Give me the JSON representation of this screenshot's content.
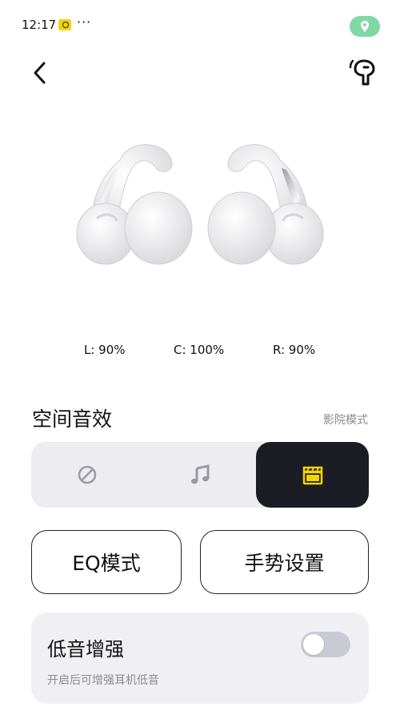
{
  "status_bar": {
    "time": "12:17",
    "dots": "···",
    "app_icon": "app-notification-icon",
    "location_icon": "location-pin-icon"
  },
  "header": {
    "back_icon": "back-arrow-icon",
    "device_icon": "earbud-icon"
  },
  "battery": {
    "left": "L: 90%",
    "case": "C: 100%",
    "right": "R: 90%"
  },
  "spatial_audio": {
    "title": "空间音效",
    "mode_label": "影院模式",
    "options": [
      {
        "icon": "off-circle-icon",
        "selected": false
      },
      {
        "icon": "music-note-icon",
        "selected": false
      },
      {
        "icon": "clapperboard-icon",
        "selected": true
      }
    ]
  },
  "buttons": {
    "eq": "EQ模式",
    "gesture": "手势设置"
  },
  "bass_boost": {
    "title": "低音增强",
    "subtitle": "开启后可增强耳机低音",
    "enabled": false
  },
  "colors": {
    "accent_yellow": "#f5d400",
    "selected_bg": "#1c1c24",
    "location_green": "#7fd8a6"
  }
}
